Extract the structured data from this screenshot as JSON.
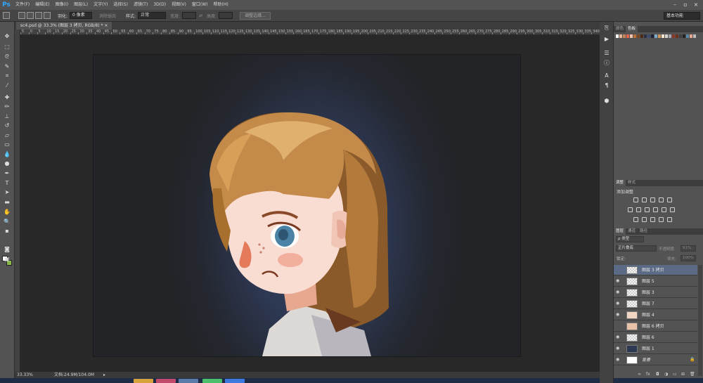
{
  "app": {
    "logo": "Ps"
  },
  "menu": [
    "文件(F)",
    "编辑(E)",
    "图像(I)",
    "图层(L)",
    "文字(Y)",
    "选择(S)",
    "滤镜(T)",
    "3D(D)",
    "视图(V)",
    "窗口(W)",
    "帮助(H)"
  ],
  "options": {
    "feather_label": "羽化:",
    "feather_value": "0 像素",
    "antialias_label": "消除锯齿",
    "style_label": "样式:",
    "style_value": "正常",
    "width_label": "宽度:",
    "height_label": "高度:",
    "refine_button": "调整边缘...",
    "workspace": "基本功能"
  },
  "document": {
    "tab_title": "sc4.psd @ 33.3% (图层 3 拷贝, RGB/8) *"
  },
  "ruler": [
    "5",
    "0",
    "5",
    "10",
    "15",
    "20",
    "25",
    "30",
    "35",
    "40",
    "45",
    "50",
    "55",
    "60",
    "65",
    "70",
    "75",
    "80",
    "85",
    "90",
    "95",
    "100",
    "105",
    "110",
    "115",
    "120",
    "125",
    "130",
    "135",
    "140",
    "145",
    "150",
    "155",
    "160",
    "165",
    "170",
    "175",
    "180",
    "185",
    "190",
    "195",
    "200",
    "205",
    "210",
    "215",
    "220",
    "225",
    "230",
    "235",
    "240",
    "245",
    "250",
    "255",
    "260",
    "265",
    "270",
    "275",
    "280",
    "285",
    "290",
    "295",
    "300",
    "305",
    "310",
    "315",
    "320",
    "325",
    "330",
    "335",
    "340"
  ],
  "status": {
    "zoom": "33.33%",
    "doc_info": "文档:24.9M/104.0M"
  },
  "panels": {
    "color_tabs": [
      "颜色",
      "色板"
    ],
    "adj_tabs": [
      "调整",
      "样式"
    ],
    "adj_title": "添加调整",
    "layer_tabs": [
      "图层",
      "通道",
      "路径"
    ],
    "filter_kind": "ρ 类型",
    "blend_mode": "正片叠底",
    "opacity_label": "不透明度:",
    "opacity_value": "91%",
    "lock_label": "锁定:",
    "fill_label": "填充:",
    "fill_value": "100%"
  },
  "layers": [
    {
      "name": "图层 3 拷贝",
      "selected": true,
      "visible": false
    },
    {
      "name": "图层 5",
      "selected": false,
      "visible": true
    },
    {
      "name": "图层 3",
      "selected": false,
      "visible": true
    },
    {
      "name": "图层 7",
      "selected": false,
      "visible": true
    },
    {
      "name": "图层 4",
      "selected": false,
      "visible": true
    },
    {
      "name": "图层 6 拷贝",
      "selected": false,
      "visible": false
    },
    {
      "name": "图层 6",
      "selected": false,
      "visible": true
    },
    {
      "name": "图层 1",
      "selected": false,
      "visible": true
    },
    {
      "name": "背景",
      "selected": false,
      "visible": true
    }
  ],
  "colors": {
    "accent": "#31a8ff",
    "selection": "#5b6b86",
    "canvas_bg": "#2d3853"
  }
}
